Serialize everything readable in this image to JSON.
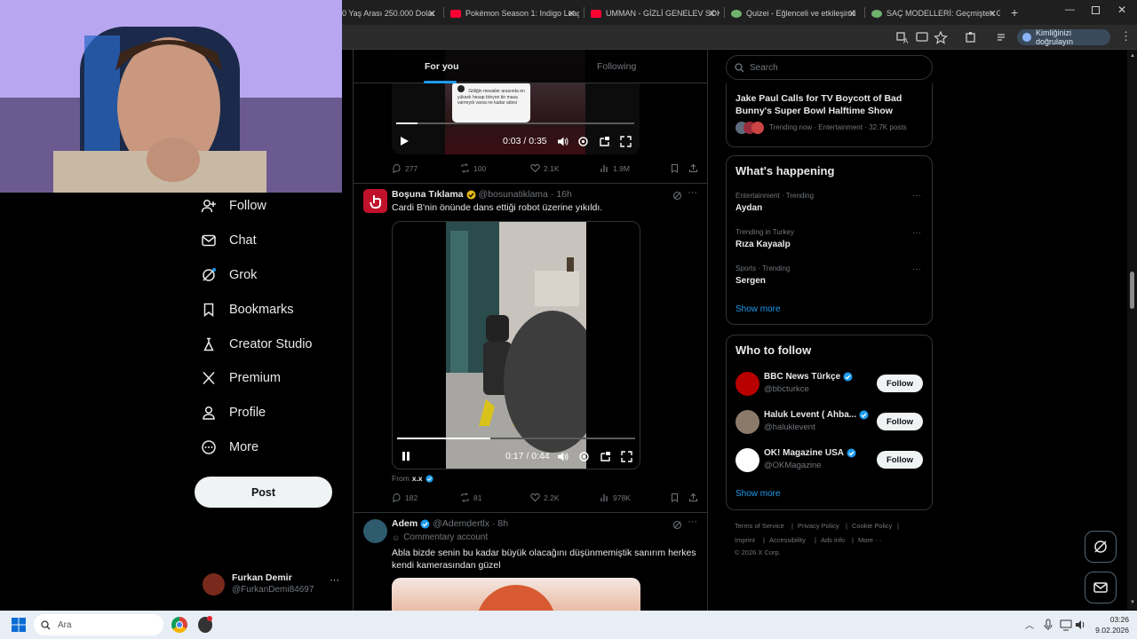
{
  "browser": {
    "tabs": [
      {
        "label": "0 Yaş Arası 250.000 Dolar",
        "icon_color": "#ff0033"
      },
      {
        "label": "Pokémon Season 1: Indigo Leag",
        "icon_color": "#ff0033"
      },
      {
        "label": "UMMAN - GİZLİ GENELEV SOK",
        "icon_color": "#ff0033"
      },
      {
        "label": "Quizei - Eğlenceli ve etkileşimli",
        "icon_color": "#6fb36f"
      },
      {
        "label": "SAÇ MODELLERİ: Geçmişten Gü",
        "icon_color": "#6fb36f"
      }
    ],
    "verify_label": "Kimliğinizi doğrulayın"
  },
  "nav": {
    "items": [
      {
        "label": "Follow",
        "icon": "follow-icon"
      },
      {
        "label": "Chat",
        "icon": "chat-icon"
      },
      {
        "label": "Grok",
        "icon": "grok-icon"
      },
      {
        "label": "Bookmarks",
        "icon": "bookmark-icon"
      },
      {
        "label": "Creator Studio",
        "icon": "creator-icon"
      },
      {
        "label": "Premium",
        "icon": "x-logo-icon"
      },
      {
        "label": "Profile",
        "icon": "profile-icon"
      },
      {
        "label": "More",
        "icon": "more-icon"
      }
    ],
    "post_label": "Post",
    "account": {
      "name": "Furkan Demir",
      "handle": "@FurkanDemi84697"
    }
  },
  "feed": {
    "tabs": [
      "For you",
      "Following"
    ],
    "post1": {
      "video_time": "0:03 / 0:35",
      "progress": 0.09,
      "stats": {
        "replies": "277",
        "reposts": "100",
        "likes": "2.1K",
        "views": "1.9M"
      },
      "embed_text": "Gitliğin mesailer arasında en yüksek hesap böryon bir masa varmıydı varsa ne kadar adesi"
    },
    "post2": {
      "author": "Boşuna Tıklama",
      "handle": "@bosunatiklama",
      "time": "· 16h",
      "text": "Cardi B'nin önünde dans ettiği robot üzerine yıkıldı.",
      "video_time": "0:17 / 0:44",
      "progress": 0.39,
      "from_label": "From",
      "from_user": "x.x",
      "stats": {
        "replies": "182",
        "reposts": "81",
        "likes": "2.2K",
        "views": "978K"
      }
    },
    "post3": {
      "author": "Adem",
      "handle": "@Ademdertlx",
      "time": "· 8h",
      "badge": "Commentary account",
      "text": "Abla bizde senin bu kadar büyük olacağını düşünmemiştik sanırım herkes kendi kamerasından güzel"
    }
  },
  "right": {
    "search_placeholder": "Search",
    "top_trend": {
      "title": "Jake Paul Calls for TV Boycott of Bad Bunny's Super Bowl Halftime Show",
      "meta": "Trending now · Entertainment · 32.7K posts"
    },
    "whats_happening": {
      "title": "What's happening",
      "trends": [
        {
          "meta": "Entertainment · Trending",
          "name": "Aydan"
        },
        {
          "meta": "Trending in Turkey",
          "name": "Rıza Kayaalp"
        },
        {
          "meta": "Sports · Trending",
          "name": "Sergen"
        }
      ],
      "show_more": "Show more"
    },
    "who_to_follow": {
      "title": "Who to follow",
      "users": [
        {
          "name": "BBC News Türkçe",
          "handle": "@bbcturkce",
          "follow": "Follow"
        },
        {
          "name": "Haluk Levent ( Ahba...",
          "handle": "@haluklevent",
          "follow": "Follow"
        },
        {
          "name": "OK! Magazine USA",
          "handle": "@OKMagazine",
          "follow": "Follow"
        }
      ],
      "show_more": "Show more"
    },
    "footer": {
      "links": [
        "Terms of Service",
        "Privacy Policy",
        "Cookie Policy",
        "Imprint",
        "Accessibility",
        "Ads info",
        "More ···"
      ],
      "copyright": "© 2026 X Corp."
    }
  },
  "taskbar": {
    "search_placeholder": "Ara",
    "time": "03:26",
    "date": "9.02.2026"
  }
}
